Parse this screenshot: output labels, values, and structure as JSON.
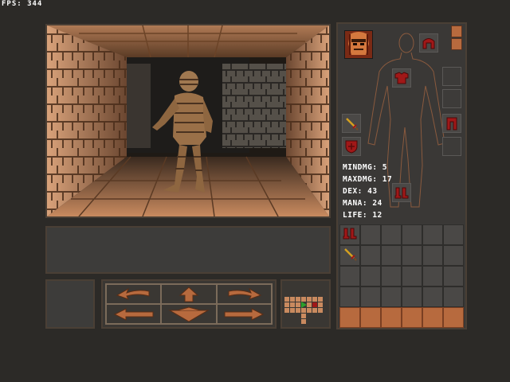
{
  "hud": {
    "fps_label": "FPS: 344"
  },
  "viewport": {
    "scene": "dungeon-corridor",
    "monster": "mummy"
  },
  "movement": {
    "buttons": [
      {
        "name": "turn-left-button",
        "icon": "turn-left-arrow-icon"
      },
      {
        "name": "move-forward-button",
        "icon": "up-arrow-icon"
      },
      {
        "name": "turn-right-button",
        "icon": "turn-right-arrow-icon"
      },
      {
        "name": "strafe-left-button",
        "icon": "left-arrow-icon"
      },
      {
        "name": "move-backward-button",
        "icon": "down-arrow-icon"
      },
      {
        "name": "strafe-right-button",
        "icon": "right-arrow-icon"
      }
    ]
  },
  "character": {
    "stats": [
      {
        "key": "mindmg",
        "text": "MINDMG: 5"
      },
      {
        "key": "maxdmg",
        "text": "MAXDMG: 17"
      },
      {
        "key": "dex",
        "text": "DEX: 43"
      },
      {
        "key": "mana",
        "text": "MANA: 24"
      },
      {
        "key": "life",
        "text": "LIFE: 12"
      }
    ],
    "equipment": {
      "head": "helmet-icon",
      "torso": "armor-icon",
      "weapon": "sword-icon",
      "shield": "shield-icon",
      "legs": "leg-armor-icon",
      "feet": "boots-icon"
    }
  },
  "inventory": {
    "rows": 5,
    "cols": 6,
    "items": [
      {
        "slot": 0,
        "icon": "boots-icon"
      },
      {
        "slot": 6,
        "icon": "sword-icon"
      }
    ]
  },
  "colors": {
    "accent": "#b76a3e",
    "item_red": "#a01818",
    "panel_border": "#4a3f35",
    "panel_bg": "#3a3836"
  }
}
